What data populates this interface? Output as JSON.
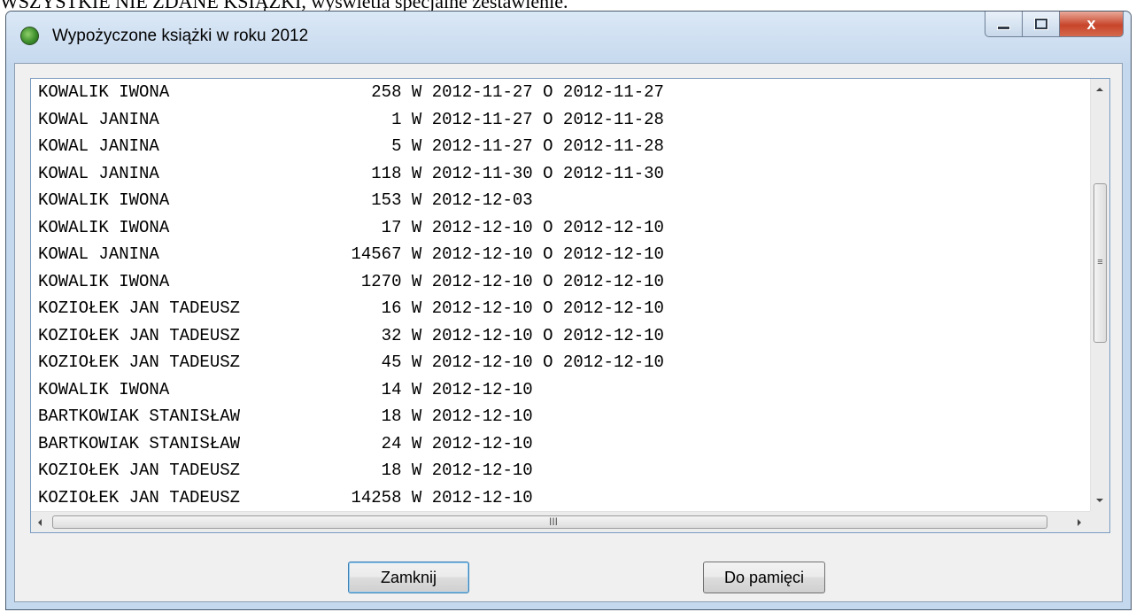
{
  "document": {
    "caption_fragment": "WSZYSTKIE NIE ZDANE KSIĄŻKI, wyświetla specjalne zestawienie."
  },
  "window": {
    "title": "Wypożyczone książki w roku 2012",
    "controls": {
      "minimize": "minimize",
      "maximize": "maximize",
      "close": "x"
    }
  },
  "loans": [
    {
      "name": "KOWALIK IWONA",
      "number": "258",
      "borrowed": "W 2012-11-27",
      "returned": "O 2012-11-27"
    },
    {
      "name": "KOWAL JANINA",
      "number": "1",
      "borrowed": "W 2012-11-27",
      "returned": "O 2012-11-28"
    },
    {
      "name": "KOWAL JANINA",
      "number": "5",
      "borrowed": "W 2012-11-27",
      "returned": "O 2012-11-28"
    },
    {
      "name": "KOWAL JANINA",
      "number": "118",
      "borrowed": "W 2012-11-30",
      "returned": "O 2012-11-30"
    },
    {
      "name": "KOWALIK IWONA",
      "number": "153",
      "borrowed": "W 2012-12-03",
      "returned": ""
    },
    {
      "name": "KOWALIK IWONA",
      "number": "17",
      "borrowed": "W 2012-12-10",
      "returned": "O 2012-12-10"
    },
    {
      "name": "KOWAL JANINA",
      "number": "14567",
      "borrowed": "W 2012-12-10",
      "returned": "O 2012-12-10"
    },
    {
      "name": "KOWALIK IWONA",
      "number": "1270",
      "borrowed": "W 2012-12-10",
      "returned": "O 2012-12-10"
    },
    {
      "name": "KOZIOŁEK JAN TADEUSZ",
      "number": "16",
      "borrowed": "W 2012-12-10",
      "returned": "O 2012-12-10"
    },
    {
      "name": "KOZIOŁEK JAN TADEUSZ",
      "number": "32",
      "borrowed": "W 2012-12-10",
      "returned": "O 2012-12-10"
    },
    {
      "name": "KOZIOŁEK JAN TADEUSZ",
      "number": "45",
      "borrowed": "W 2012-12-10",
      "returned": "O 2012-12-10"
    },
    {
      "name": "KOWALIK IWONA",
      "number": "14",
      "borrowed": "W 2012-12-10",
      "returned": ""
    },
    {
      "name": "BARTKOWIAK STANISŁAW",
      "number": "18",
      "borrowed": "W 2012-12-10",
      "returned": ""
    },
    {
      "name": "BARTKOWIAK STANISŁAW",
      "number": "24",
      "borrowed": "W 2012-12-10",
      "returned": ""
    },
    {
      "name": "KOZIOŁEK JAN TADEUSZ",
      "number": "18",
      "borrowed": "W 2012-12-10",
      "returned": ""
    },
    {
      "name": "KOZIOŁEK JAN TADEUSZ",
      "number": "14258",
      "borrowed": "W 2012-12-10",
      "returned": ""
    }
  ],
  "scrollbars": {
    "horizontal_grip": "III",
    "vertical_grip": "≡"
  },
  "buttons": {
    "close_label": "Zamknij",
    "copy_label": "Do pamięci"
  }
}
